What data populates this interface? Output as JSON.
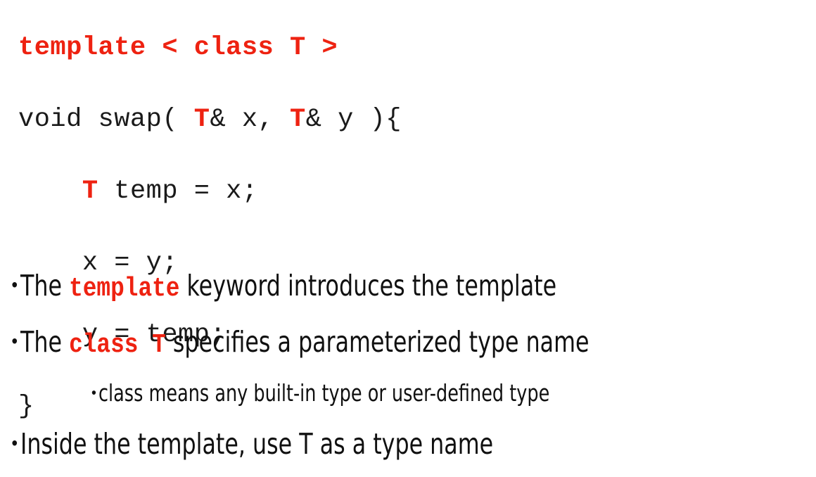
{
  "slide": {
    "background_color": "#ffffff",
    "text_color": "#101010",
    "accent_color": "#ee2211"
  },
  "code_block": {
    "language": "cpp",
    "lines": [
      {
        "segments": [
          {
            "text": "template < class T >",
            "style": "keyword-red-bold"
          }
        ]
      },
      {
        "segments": [
          {
            "text": "void swap( ",
            "style": "plain"
          },
          {
            "text": "T",
            "style": "type-red-bold"
          },
          {
            "text": "& x, ",
            "style": "plain"
          },
          {
            "text": "T",
            "style": "type-red-bold"
          },
          {
            "text": "& y ){",
            "style": "plain"
          }
        ]
      },
      {
        "segments": [
          {
            "text": "    ",
            "style": "plain"
          },
          {
            "text": "T",
            "style": "type-red-bold"
          },
          {
            "text": " temp = x;",
            "style": "plain"
          }
        ]
      },
      {
        "segments": [
          {
            "text": "    x = y;",
            "style": "plain"
          }
        ]
      },
      {
        "segments": [
          {
            "text": "    y = temp;",
            "style": "plain"
          }
        ]
      },
      {
        "segments": [
          {
            "text": "}",
            "style": "plain"
          }
        ]
      }
    ]
  },
  "bullets": [
    {
      "level": 1,
      "marker": "•",
      "segments": [
        {
          "text": "The ",
          "style": "plain"
        },
        {
          "text": "template",
          "style": "code-red"
        },
        {
          "text": " keyword introduces the template",
          "style": "plain"
        }
      ]
    },
    {
      "level": 1,
      "marker": "•",
      "segments": [
        {
          "text": "The ",
          "style": "plain"
        },
        {
          "text": "class  T",
          "style": "code-red"
        },
        {
          "text": " specifies a parameterized type name",
          "style": "plain"
        }
      ]
    },
    {
      "level": 2,
      "marker": "•",
      "segments": [
        {
          "text": "class means any built-in type or user-defined type",
          "style": "plain"
        }
      ]
    },
    {
      "level": 1,
      "marker": "•",
      "segments": [
        {
          "text": "Inside the template, use T as a type name",
          "style": "plain"
        }
      ]
    }
  ]
}
